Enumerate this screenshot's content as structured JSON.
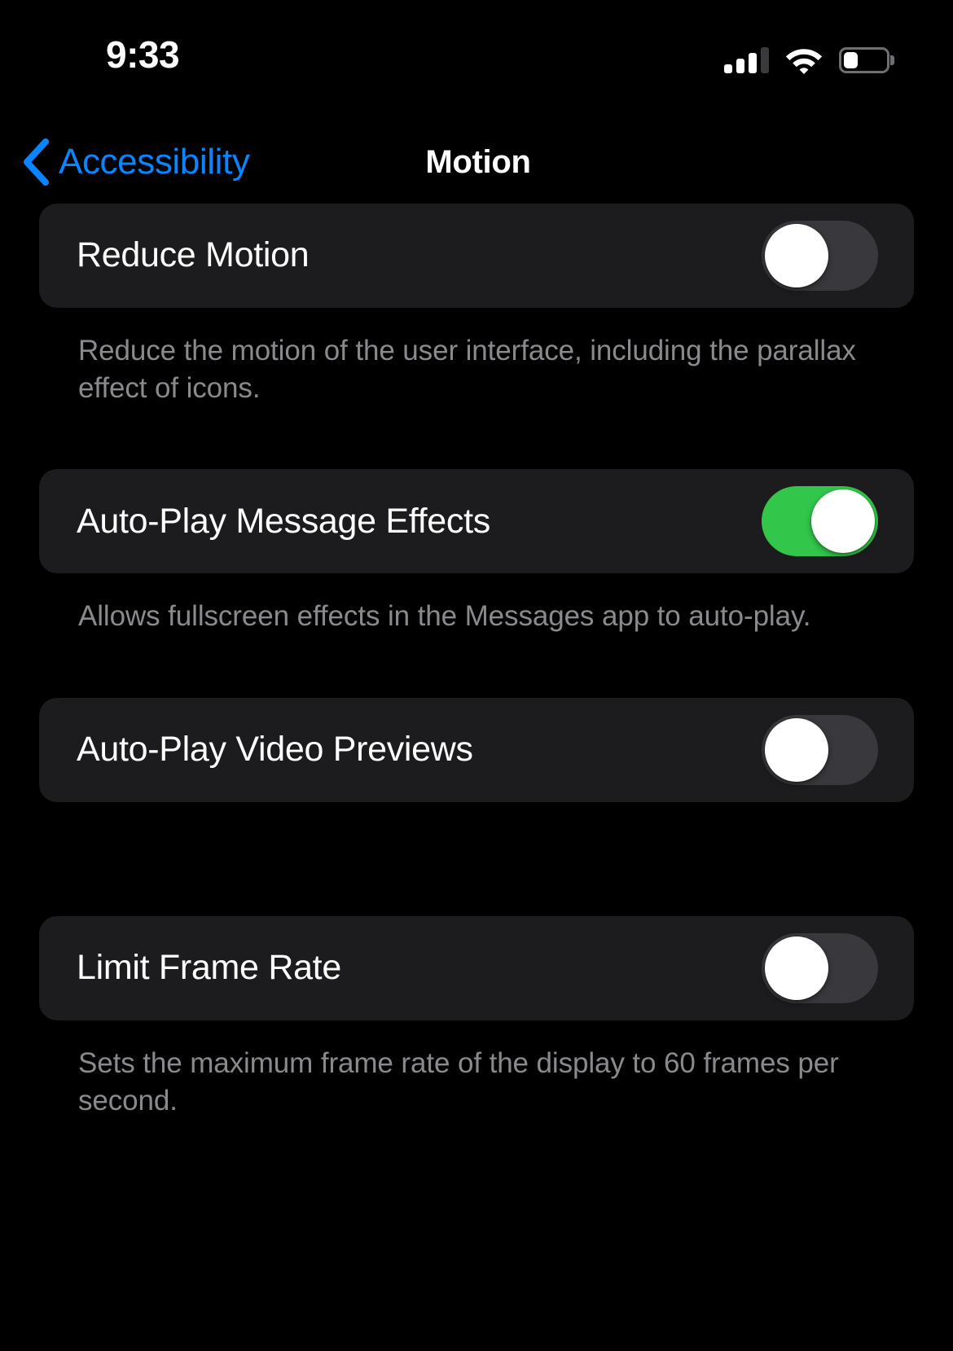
{
  "status_bar": {
    "time": "9:33",
    "cellular_icon": "cellular-signal-icon",
    "cellular_bars_filled": 3,
    "cellular_bars_total": 4,
    "wifi_icon": "wifi-icon",
    "wifi_strength": "full",
    "battery_icon": "battery-icon",
    "battery_level_percent": 34
  },
  "nav": {
    "back_icon": "chevron-left-icon",
    "back_label": "Accessibility",
    "title": "Motion"
  },
  "colors": {
    "background": "#000000",
    "card": "#1C1C1E",
    "accent_blue": "#0A84FF",
    "toggle_on_green": "#32C74B",
    "toggle_off_gray": "#39393D",
    "footnote_gray": "#8A8A8E",
    "label_white": "#FFFFFF"
  },
  "groups": [
    {
      "label": "Reduce Motion",
      "toggle_state": "off",
      "footnote": "Reduce the motion of the user interface, including the parallax effect of icons."
    },
    {
      "label": "Auto-Play Message Effects",
      "toggle_state": "on",
      "footnote": "Allows fullscreen effects in the Messages app to auto-play."
    },
    {
      "label": "Auto-Play Video Previews",
      "toggle_state": "off",
      "footnote": ""
    },
    {
      "label": "Limit Frame Rate",
      "toggle_state": "off",
      "footnote": "Sets the maximum frame rate of the display to 60 frames per second."
    }
  ]
}
